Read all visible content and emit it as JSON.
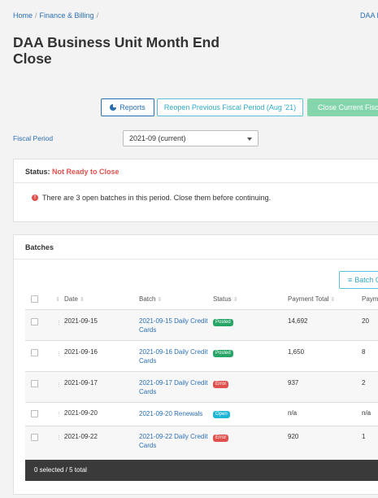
{
  "breadcrumb": {
    "home": "Home",
    "section": "Finance & Billing",
    "sep": "/"
  },
  "top_right_link": "DAA B",
  "page_title": "DAA Business Unit Month End Close",
  "buttons": {
    "reports": "Reports",
    "reopen": "Reopen Previous Fiscal Period (Aug '21)",
    "close": "Close Current Fiscal Period"
  },
  "fiscal_period": {
    "label": "Fiscal Period",
    "value": "2021-09 (current)"
  },
  "status": {
    "label": "Status:",
    "value": "Not Ready to Close",
    "message": "There are 3 open batches in this period. Close them before continuing."
  },
  "batches": {
    "title": "Batches",
    "batch_button": "Batch Close",
    "columns": [
      "Date",
      "Batch",
      "Status",
      "Payment Total",
      "Payments"
    ],
    "rows": [
      {
        "date": "2021-09-15",
        "batch": "2021-09-15 Daily Credit Cards",
        "status": "Posted",
        "total": "14,692",
        "payments": "20"
      },
      {
        "date": "2021-09-16",
        "batch": "2021-09-16 Daily Credit Cards",
        "status": "Posted",
        "total": "1,650",
        "payments": "8"
      },
      {
        "date": "2021-09-17",
        "batch": "2021-09-17 Daily Credit Cards",
        "status": "Error",
        "total": "937",
        "payments": "2"
      },
      {
        "date": "2021-09-20",
        "batch": "2021-09-20 Renewals",
        "status": "Open",
        "total": "n/a",
        "payments": "n/a"
      },
      {
        "date": "2021-09-22",
        "batch": "2021-09-22 Daily Credit Cards",
        "status": "Error",
        "total": "920",
        "payments": "1"
      }
    ],
    "footer": "0 selected / 5 total"
  },
  "colors": {
    "link": "#2a6fb4",
    "posted": "#27a567",
    "error": "#e0514e",
    "open": "#1fb6d6",
    "close_button": "#85d6ad"
  }
}
